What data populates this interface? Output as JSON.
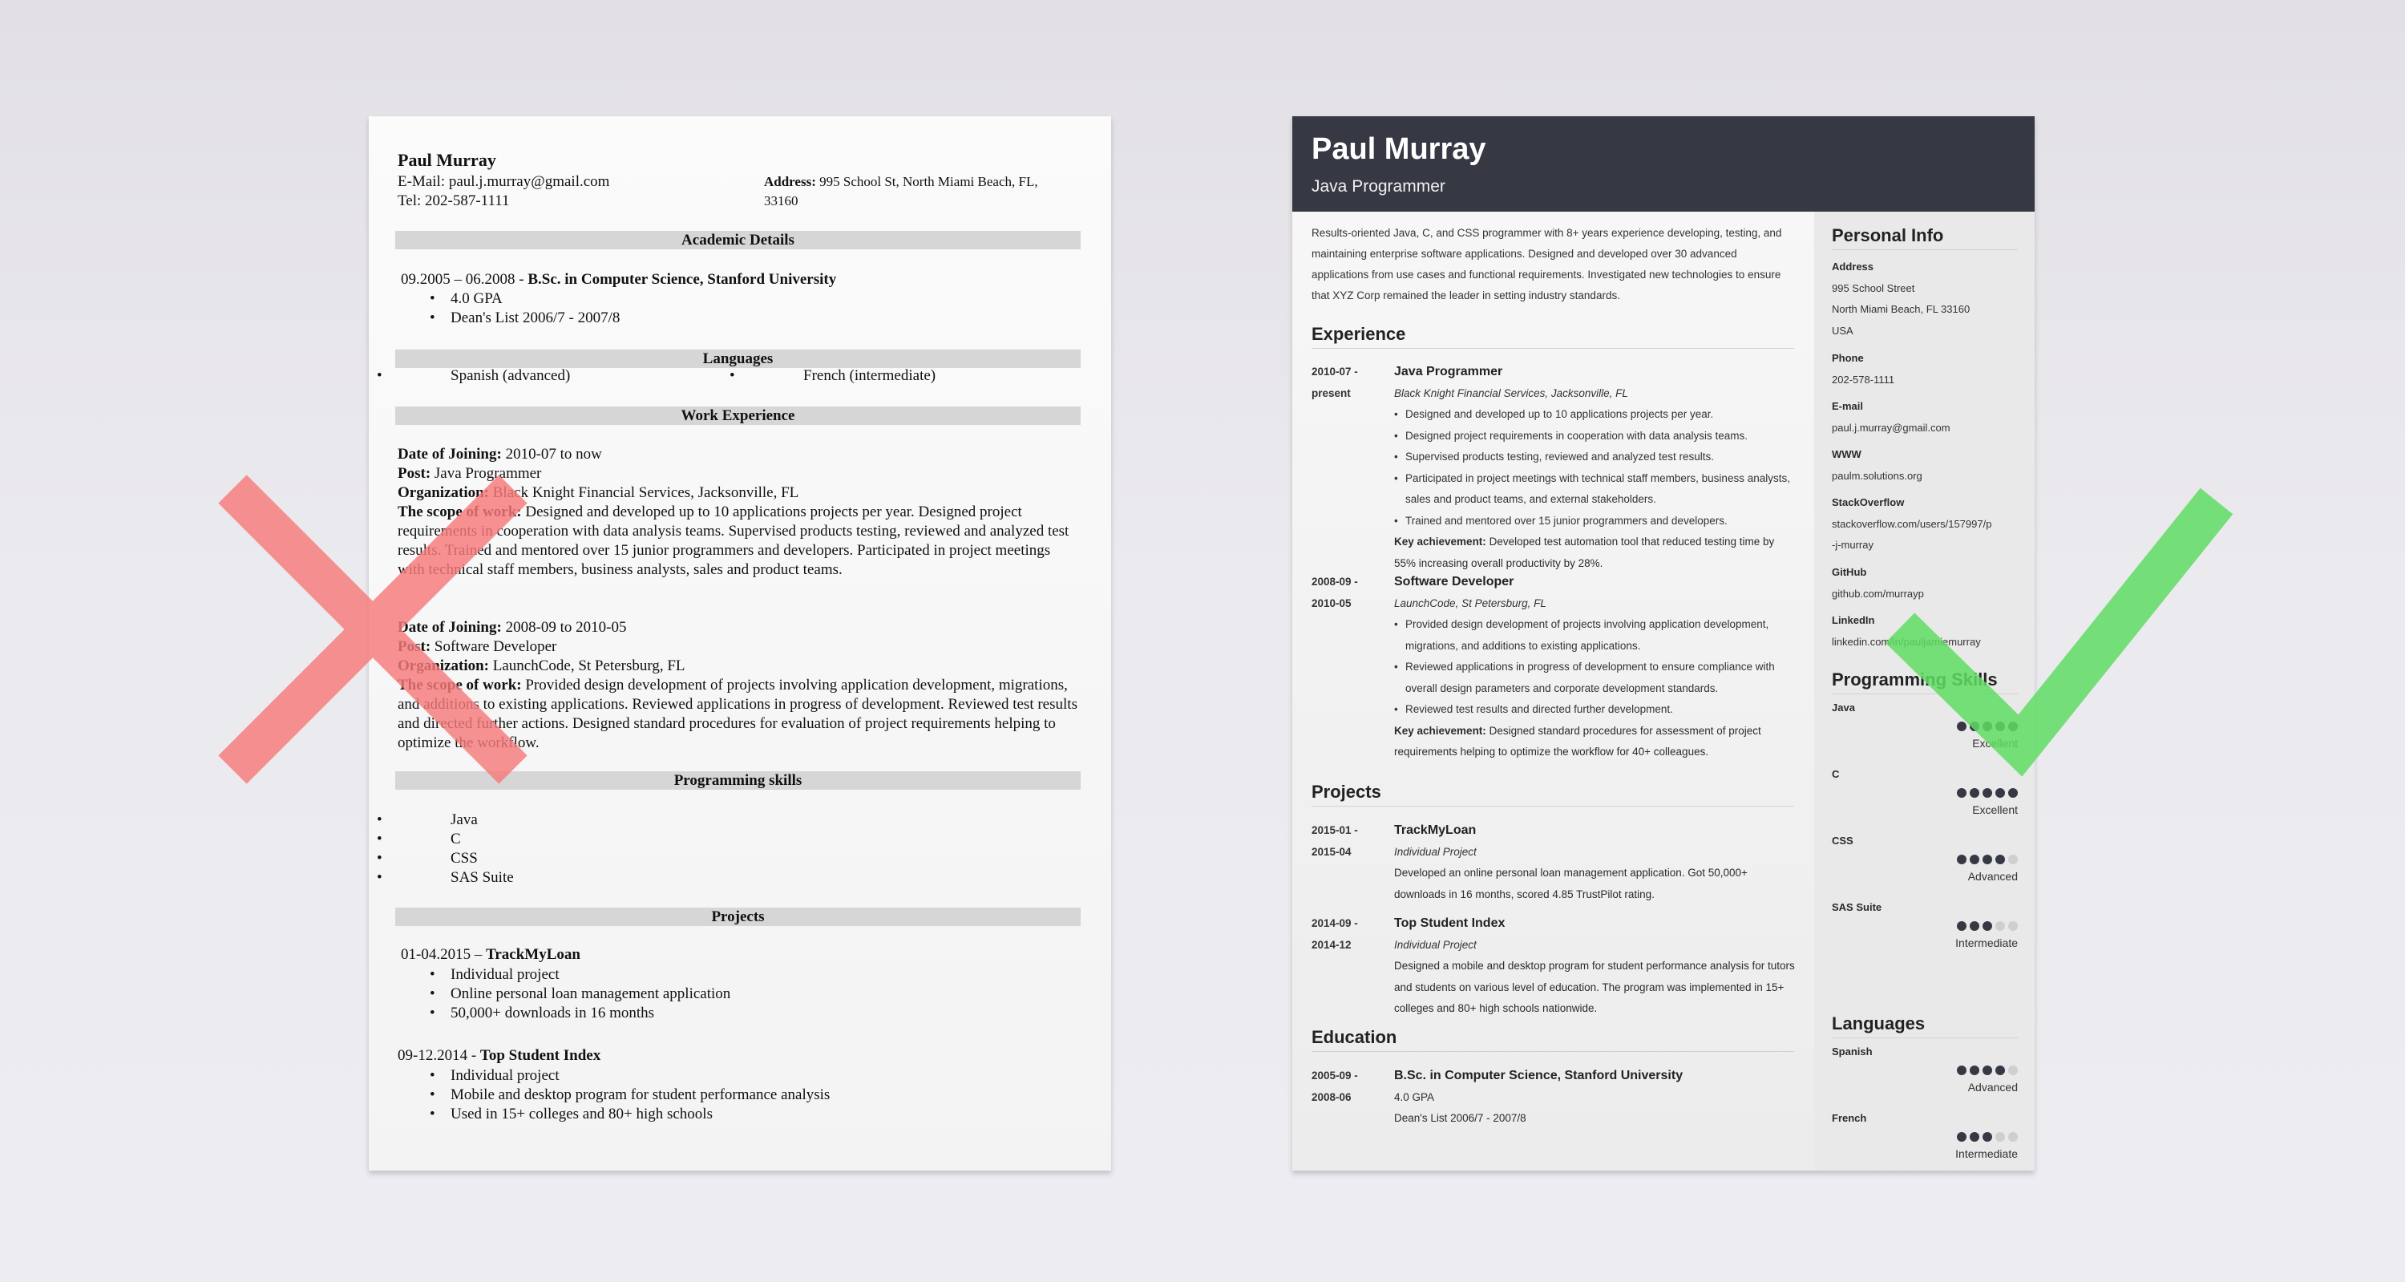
{
  "bad_resume": {
    "name": "Paul Murray",
    "email_line": "E-Mail: paul.j.murray@gmail.com",
    "tel_line": "Tel: 202-587-1111",
    "address_label": "Address:",
    "address_value_line1": " 995 School St, North Miami Beach, FL,",
    "address_value_line2": "33160",
    "sections": {
      "academic": "Academic Details",
      "languages": "Languages",
      "work": "Work Experience",
      "skills": "Programming skills",
      "projects": "Projects"
    },
    "education": {
      "dates": "09.2005 – 06.2008 - ",
      "degree": "B.Sc. in Computer Science, Stanford University",
      "bullets": [
        "4.0 GPA",
        "Dean's List 2006/7 - 2007/8"
      ]
    },
    "languages": [
      "Spanish (advanced)",
      "French (intermediate)"
    ],
    "labels": {
      "date_of_joining": "Date of Joining:",
      "post": "Post:",
      "organization": "Organization:",
      "scope": "The scope of work:"
    },
    "jobs": [
      {
        "dates": " 2010-07 to now",
        "post": " Java Programmer",
        "organization": " Black Knight Financial Services, Jacksonville, FL",
        "scope": " Designed and developed up to 10 applications projects per year. Designed project requirements in cooperation with data analysis teams. Supervised products testing, reviewed and analyzed test results. Trained and mentored over 15 junior programmers and developers. Participated in project meetings with technical staff members, business analysts, sales and product teams."
      },
      {
        "dates": " 2008-09 to 2010-05",
        "post": " Software Developer",
        "organization": " LaunchCode, St Petersburg, FL",
        "scope": " Provided design development of projects involving application development, migrations, and additions to existing applications. Reviewed applications in progress of development. Reviewed test results and directed further actions. Designed standard procedures for evaluation of project requirements helping to optimize the workflow."
      }
    ],
    "skills": [
      "Java",
      "C",
      "CSS",
      "SAS Suite"
    ],
    "projects": [
      {
        "dates": "01-04.2015 – ",
        "name": "TrackMyLoan",
        "bullets": [
          "Individual project",
          "Online personal loan management application",
          "50,000+ downloads in 16 months"
        ]
      },
      {
        "dates": "09-12.2014 - ",
        "name": "Top Student Index",
        "bullets": [
          "Individual project",
          "Mobile and desktop program for student performance analysis",
          "Used in 15+ colleges and 80+ high schools"
        ]
      }
    ]
  },
  "good_resume": {
    "name": "Paul Murray",
    "title": "Java Programmer",
    "summary": "Results-oriented Java, C, and CSS programmer with 8+ years experience developing, testing, and maintaining enterprise software applications. Designed and developed over 30 advanced applications from use cases and functional requirements. Investigated new technologies to ensure that XYZ Corp remained the leader in setting industry standards.",
    "sections": {
      "experience": "Experience",
      "projects": "Projects",
      "education": "Education",
      "personal_info": "Personal Info",
      "skills": "Programming Skills",
      "languages": "Languages"
    },
    "key_label": "Key achievement:",
    "experience": [
      {
        "date_start": "2010-07 -",
        "date_end": "present",
        "role": "Java Programmer",
        "org": "Black Knight Financial Services, Jacksonville, FL",
        "bullets": [
          "Designed and developed up to 10 applications projects per year.",
          "Designed project requirements in cooperation with data analysis teams.",
          "Supervised products testing, reviewed and analyzed test results.",
          "Participated in project meetings with technical staff members, business analysts, sales and product teams, and external stakeholders.",
          "Trained and mentored over 15 junior programmers and developers."
        ],
        "key": " Developed test automation tool that reduced testing time by 55% increasing overall productivity by 28%."
      },
      {
        "date_start": "2008-09 -",
        "date_end": "2010-05",
        "role": "Software Developer",
        "org": "LaunchCode, St Petersburg, FL",
        "bullets": [
          "Provided design development of projects involving application development, migrations, and additions to existing applications.",
          "Reviewed applications in progress of development to ensure compliance with overall design parameters and corporate development standards.",
          "Reviewed test results and directed further development."
        ],
        "key": " Designed standard procedures for assessment of project requirements helping to optimize the workflow for 40+ colleagues."
      }
    ],
    "projects": [
      {
        "date_start": "2015-01 -",
        "date_end": "2015-04",
        "name": "TrackMyLoan",
        "type": "Individual Project",
        "desc": "Developed an online personal loan management application. Got 50,000+ downloads in 16 months, scored 4.85 TrustPilot rating."
      },
      {
        "date_start": "2014-09 -",
        "date_end": "2014-12",
        "name": "Top Student Index",
        "type": "Individual Project",
        "desc": "Designed a mobile and desktop program for student performance analysis for tutors and students on various level of education. The program was implemented in 15+ colleges and 80+ high schools nationwide."
      }
    ],
    "education": {
      "date_start": "2005-09 -",
      "date_end": "2008-06",
      "degree": "B.Sc. in Computer Science, Stanford University",
      "lines": [
        "4.0 GPA",
        "Dean's List 2006/7 - 2007/8"
      ]
    },
    "personal_info": [
      {
        "label": "Address",
        "lines": [
          "995 School Street",
          "North Miami Beach, FL 33160",
          "USA"
        ]
      },
      {
        "label": "Phone",
        "lines": [
          "202-578-1111"
        ]
      },
      {
        "label": "E-mail",
        "lines": [
          "paul.j.murray@gmail.com"
        ]
      },
      {
        "label": "WWW",
        "lines": [
          "paulm.solutions.org"
        ]
      },
      {
        "label": "StackOverflow",
        "lines": [
          "stackoverflow.com/users/157997/p",
          "-j-murray"
        ]
      },
      {
        "label": "GitHub",
        "lines": [
          "github.com/murrayp"
        ]
      },
      {
        "label": "LinkedIn",
        "lines": [
          "linkedin.com/in/pauljamiemurray"
        ]
      }
    ],
    "skills": [
      {
        "name": "Java",
        "rating": 5,
        "max": 5,
        "level": "Excellent"
      },
      {
        "name": "C",
        "rating": 5,
        "max": 5,
        "level": "Excellent"
      },
      {
        "name": "CSS",
        "rating": 4,
        "max": 5,
        "level": "Advanced"
      },
      {
        "name": "SAS Suite",
        "rating": 3,
        "max": 5,
        "level": "Intermediate"
      }
    ],
    "languages": [
      {
        "name": "Spanish",
        "rating": 4,
        "max": 5,
        "level": "Advanced"
      },
      {
        "name": "French",
        "rating": 3,
        "max": 5,
        "level": "Intermediate"
      }
    ]
  },
  "marks": {
    "bad_icon": "x-cross-icon",
    "good_icon": "checkmark-icon",
    "bad_color": "#f77b7b",
    "good_color": "#5fdc63"
  }
}
